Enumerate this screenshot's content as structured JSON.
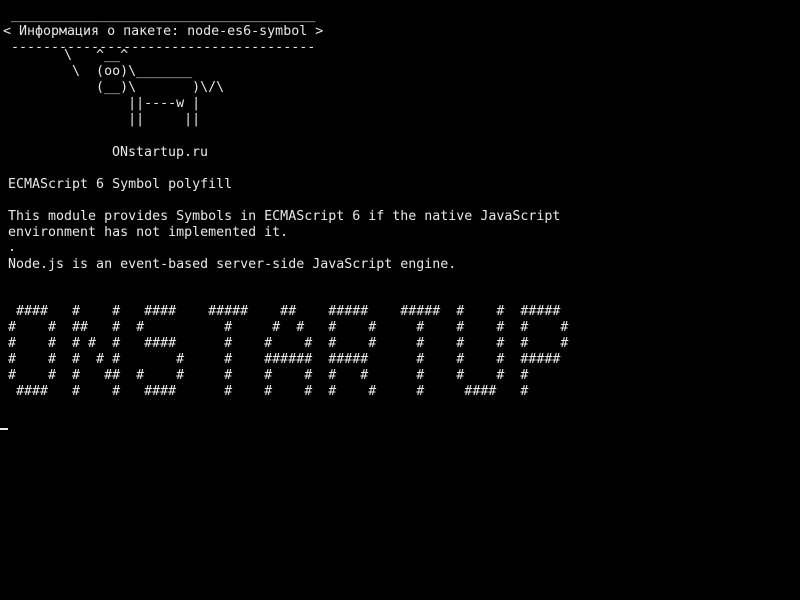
{
  "terminal": {
    "cowsay": {
      "top_border": " ______________________________________",
      "message_line": "< Информация о пакете: node-es6-symbol >",
      "bottom_border": " --------------------------------------"
    },
    "cow_art": [
      "       \\   ^__^",
      "        \\  (oo)\\_______",
      "           (__)\\       )\\/\\",
      "               ||----w |",
      "               ||     ||"
    ],
    "site": "ONstartup.ru",
    "package_title": "ECMAScript 6 Symbol polyfill",
    "description": [
      "This module provides Symbols in ECMAScript 6 if the native JavaScript",
      "environment has not implemented it."
    ],
    "dot": ".",
    "node_info": "Node.js is an event-based server-side JavaScript engine.",
    "banner_art": [
      " ####   #    #   ####    #####    ##    #####    #####  #    #  #####",
      "#    #  ##   #  #          #     #  #   #    #     #    #    #  #    #",
      "#    #  # #  #   ####      #    #    #  #    #     #    #    #  #    #",
      "#    #  #  # #       #     #    ######  #####      #    #    #  #####",
      "#    #  #   ##  #    #     #    #    #  #   #      #    #    #  #",
      " ####   #    #   ####      #    #    #  #    #     #     ####   #"
    ]
  },
  "colors": {
    "background": "#000000",
    "foreground": "#e8e8e8"
  }
}
